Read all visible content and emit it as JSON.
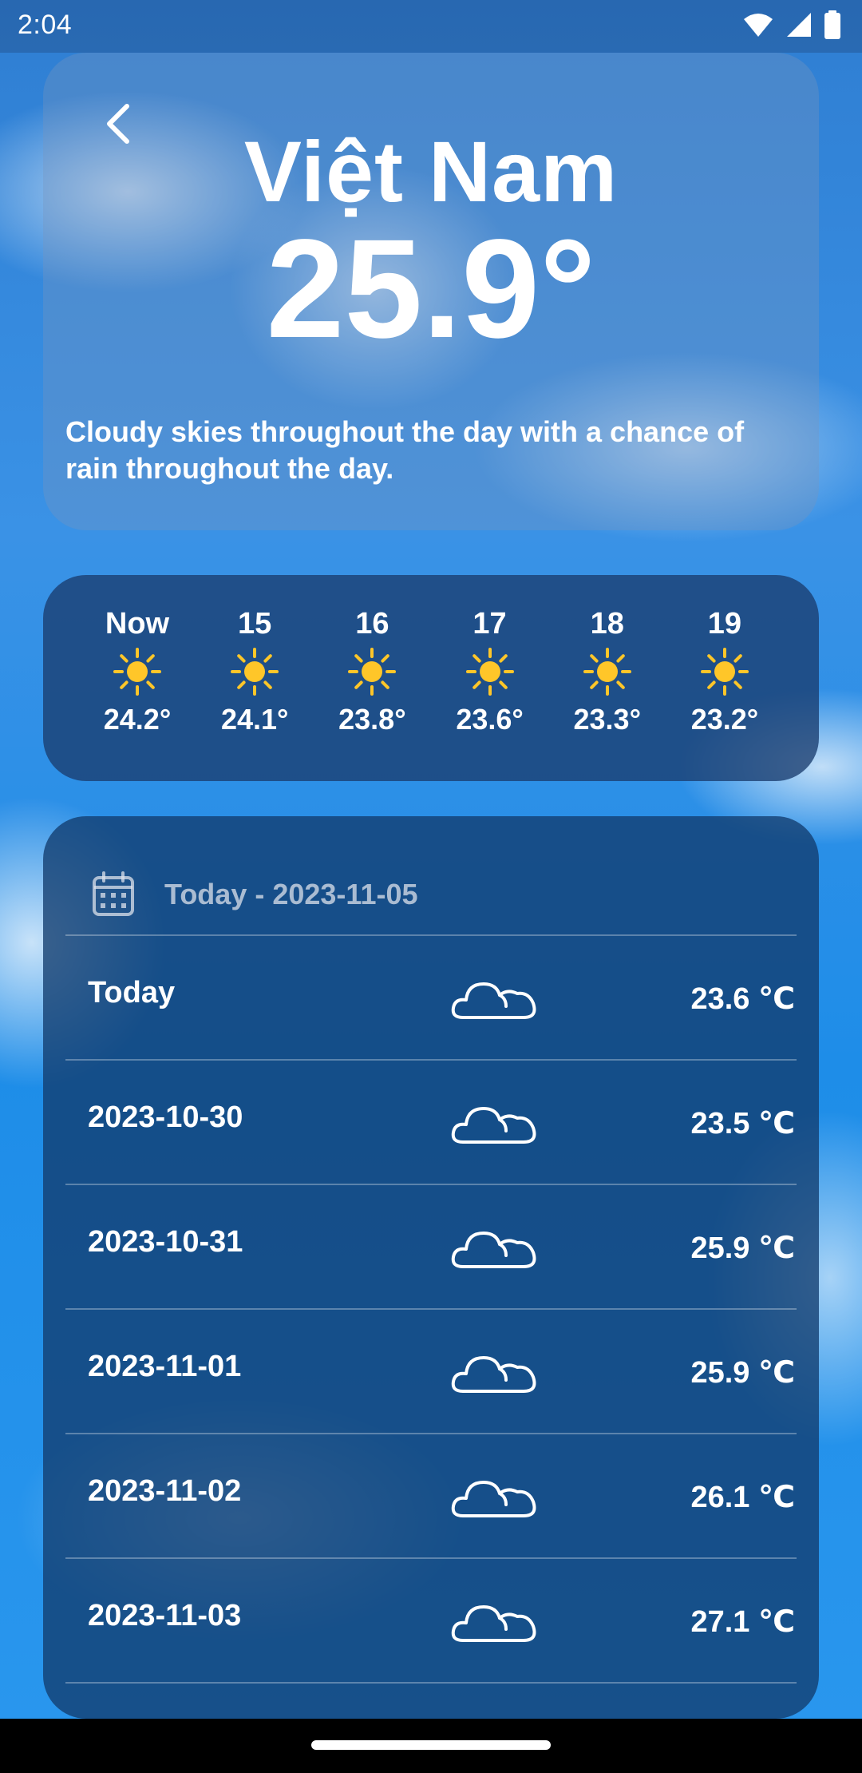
{
  "status_bar": {
    "time": "2:04",
    "icons": [
      "wifi-icon",
      "signal-icon",
      "battery-icon"
    ]
  },
  "current": {
    "city": "Việt Nam",
    "temperature": "25.9°",
    "summary": "Cloudy skies throughout the day with a chance of rain throughout the day."
  },
  "hourly": [
    {
      "label": "Now",
      "icon": "sun-icon",
      "temp": "24.2°"
    },
    {
      "label": "15",
      "icon": "sun-icon",
      "temp": "24.1°"
    },
    {
      "label": "16",
      "icon": "sun-icon",
      "temp": "23.8°"
    },
    {
      "label": "17",
      "icon": "sun-icon",
      "temp": "23.6°"
    },
    {
      "label": "18",
      "icon": "sun-icon",
      "temp": "23.3°"
    },
    {
      "label": "19",
      "icon": "sun-icon",
      "temp": "23.2°"
    }
  ],
  "daily": {
    "header": "Today - 2023-11-05",
    "header_icon": "calendar-icon",
    "rows": [
      {
        "date": "Today",
        "icon": "cloud-icon",
        "temp": "23.6 ℃"
      },
      {
        "date": "2023-10-30",
        "icon": "cloud-icon",
        "temp": "23.5 ℃"
      },
      {
        "date": "2023-10-31",
        "icon": "cloud-icon",
        "temp": "25.9 ℃"
      },
      {
        "date": "2023-11-01",
        "icon": "cloud-icon",
        "temp": "25.9 ℃"
      },
      {
        "date": "2023-11-02",
        "icon": "cloud-icon",
        "temp": "26.1 ℃"
      },
      {
        "date": "2023-11-03",
        "icon": "cloud-icon",
        "temp": "27.1 ℃"
      }
    ]
  },
  "colors": {
    "sun": "#FFC629",
    "text": "#FFFFFF",
    "sky": "#1D8FE6"
  }
}
